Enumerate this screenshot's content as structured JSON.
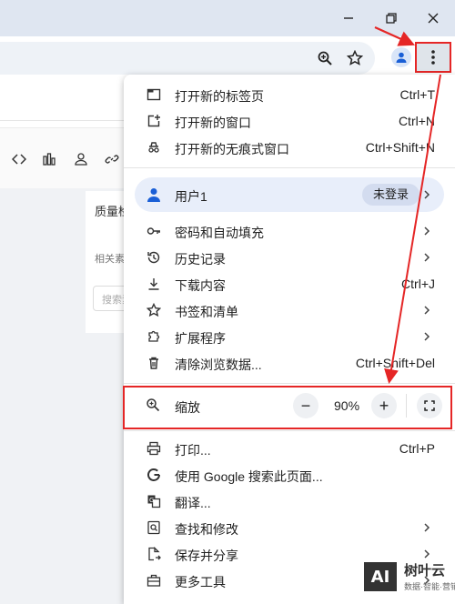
{
  "window": {
    "controls": [
      "minimize-icon",
      "restore-icon",
      "close-icon"
    ]
  },
  "toolbar": {
    "icons": [
      "zoom-icon",
      "bookmark-star-icon",
      "profile-icon",
      "more-vert-icon"
    ]
  },
  "page": {
    "card_title": "质量检",
    "card_sub": "相关素",
    "search_placeholder": "搜索素"
  },
  "menu": {
    "group1": [
      {
        "label": "打开新的标签页",
        "shortcut": "Ctrl+T",
        "icon": "new-tab-icon"
      },
      {
        "label": "打开新的窗口",
        "shortcut": "Ctrl+N",
        "icon": "new-window-icon"
      },
      {
        "label": "打开新的无痕式窗口",
        "shortcut": "Ctrl+Shift+N",
        "icon": "incognito-icon"
      }
    ],
    "profile": {
      "label": "用户1",
      "badge": "未登录"
    },
    "group2": [
      {
        "label": "密码和自动填充",
        "shortcut": "",
        "icon": "key-icon",
        "submenu": true
      },
      {
        "label": "历史记录",
        "shortcut": "",
        "icon": "history-icon",
        "submenu": true
      },
      {
        "label": "下载内容",
        "shortcut": "Ctrl+J",
        "icon": "download-icon",
        "submenu": false
      },
      {
        "label": "书签和清单",
        "shortcut": "",
        "icon": "star-icon",
        "submenu": true
      },
      {
        "label": "扩展程序",
        "shortcut": "",
        "icon": "extension-icon",
        "submenu": true
      },
      {
        "label": "清除浏览数据...",
        "shortcut": "Ctrl+Shift+Del",
        "icon": "trash-icon",
        "submenu": false
      }
    ],
    "zoom": {
      "label": "缩放",
      "minus": "−",
      "value": "90%",
      "plus": "+"
    },
    "group3": [
      {
        "label": "打印...",
        "shortcut": "Ctrl+P",
        "icon": "print-icon",
        "submenu": false
      },
      {
        "label": "使用 Google 搜索此页面...",
        "shortcut": "",
        "icon": "google-icon",
        "submenu": false
      },
      {
        "label": "翻译...",
        "shortcut": "",
        "icon": "translate-icon",
        "submenu": false
      },
      {
        "label": "查找和修改",
        "shortcut": "",
        "icon": "find-icon",
        "submenu": true
      },
      {
        "label": "保存并分享",
        "shortcut": "",
        "icon": "save-share-icon",
        "submenu": true
      },
      {
        "label": "更多工具",
        "shortcut": "",
        "icon": "toolbox-icon",
        "submenu": true
      }
    ]
  },
  "watermark": {
    "logo": "AI",
    "name": "树叶云",
    "sub": "数据·智能·营销"
  },
  "colors": {
    "annotation": "#e52626",
    "profile_bg": "#e8eefa",
    "titlebar": "#dfe6f1"
  }
}
